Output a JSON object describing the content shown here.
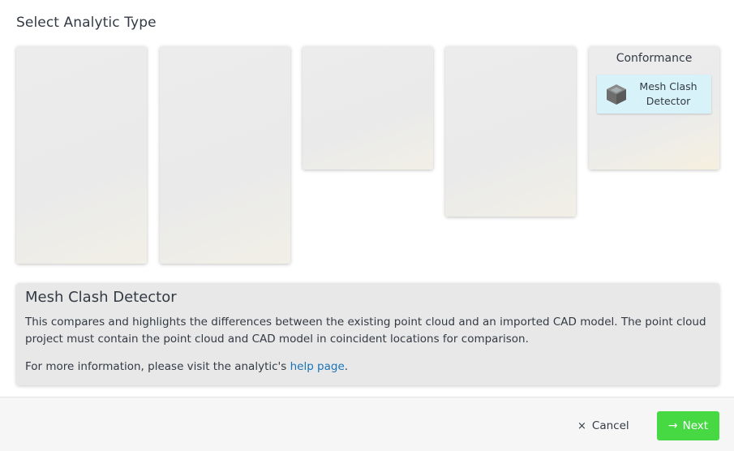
{
  "dialog": {
    "title": "Select Analytic Type"
  },
  "categories": [
    {
      "title": "",
      "options": []
    },
    {
      "title": "",
      "options": []
    },
    {
      "title": "",
      "options": []
    },
    {
      "title": "",
      "options": []
    },
    {
      "title": "Conformance",
      "options": [
        {
          "label": "Mesh Clash\nDetector",
          "icon": "cube-icon",
          "selected": true
        }
      ]
    }
  ],
  "info": {
    "title": "Mesh Clash Detector",
    "description": "This compares and highlights the differences between the existing point cloud and an imported CAD model. The point cloud project must contain the point cloud and CAD model in coincident locations for comparison.",
    "more_prefix": "For more information, please visit the analytic's ",
    "help_link": "help page",
    "more_suffix": "."
  },
  "footer": {
    "cancel_icon": "×",
    "cancel_label": "Cancel",
    "next_icon": "→",
    "next_label": "Next"
  },
  "colors": {
    "selected_option": "#d7f3f9",
    "next_button": "#47d944",
    "link": "#1a73b8"
  }
}
